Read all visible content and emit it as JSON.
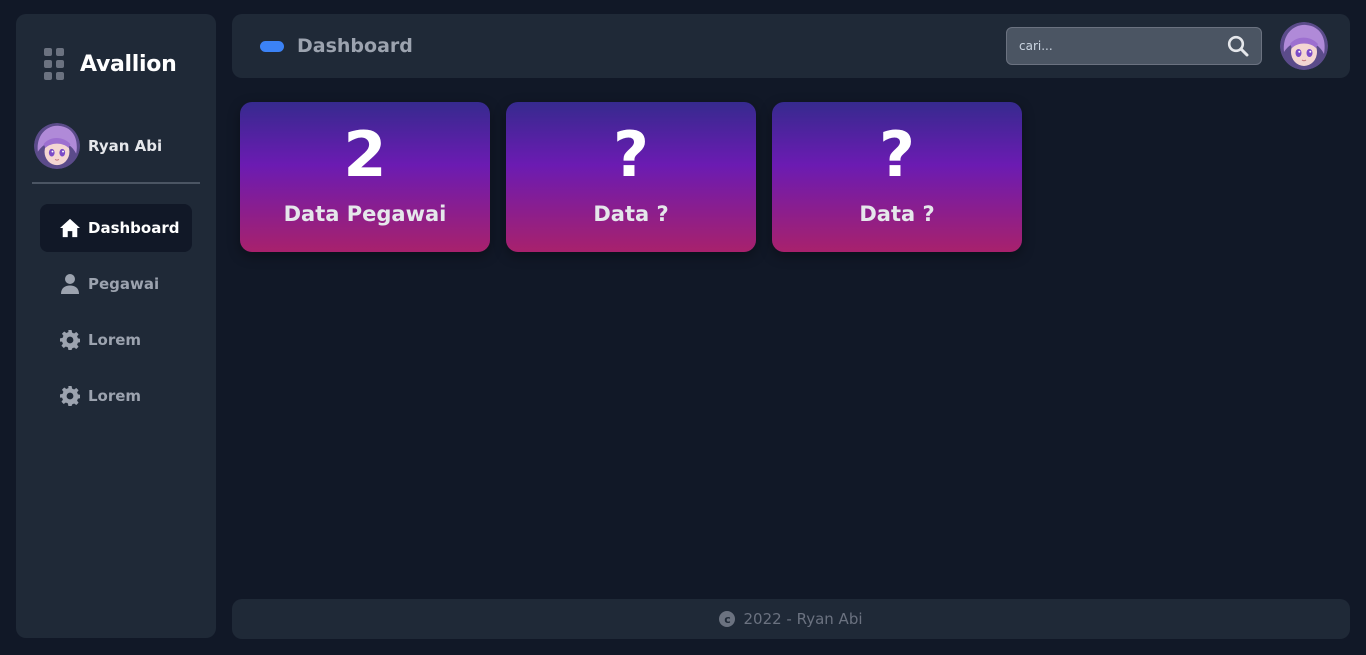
{
  "sidebar": {
    "brand_icon": "grid-dots-icon",
    "brand": "Avallion",
    "profile": {
      "name": "Ryan Abi",
      "avatar": "anime-avatar"
    },
    "items": [
      {
        "label": "Dashboard",
        "icon": "home-icon",
        "active": true
      },
      {
        "label": "Pegawai",
        "icon": "user-icon",
        "active": false
      },
      {
        "label": "Lorem",
        "icon": "gear-icon",
        "active": false
      },
      {
        "label": "Lorem",
        "icon": "gear-icon",
        "active": false
      }
    ]
  },
  "header": {
    "title": "Dashboard",
    "search": {
      "placeholder": "cari...",
      "value": "",
      "icon": "search-icon"
    },
    "avatar": "anime-avatar"
  },
  "cards": [
    {
      "value": "2",
      "label": "Data Pegawai"
    },
    {
      "value": "?",
      "label": "Data ?"
    },
    {
      "value": "?",
      "label": "Data ?"
    }
  ],
  "footer": {
    "icon": "copyright-icon",
    "text": "2022 - Ryan Abi"
  },
  "colors": {
    "background": "#111827",
    "panel": "#1f2937",
    "accent": "#3b82f6",
    "card_gradient": [
      "#362a8e",
      "#6b1bb2",
      "#a8216c"
    ]
  }
}
